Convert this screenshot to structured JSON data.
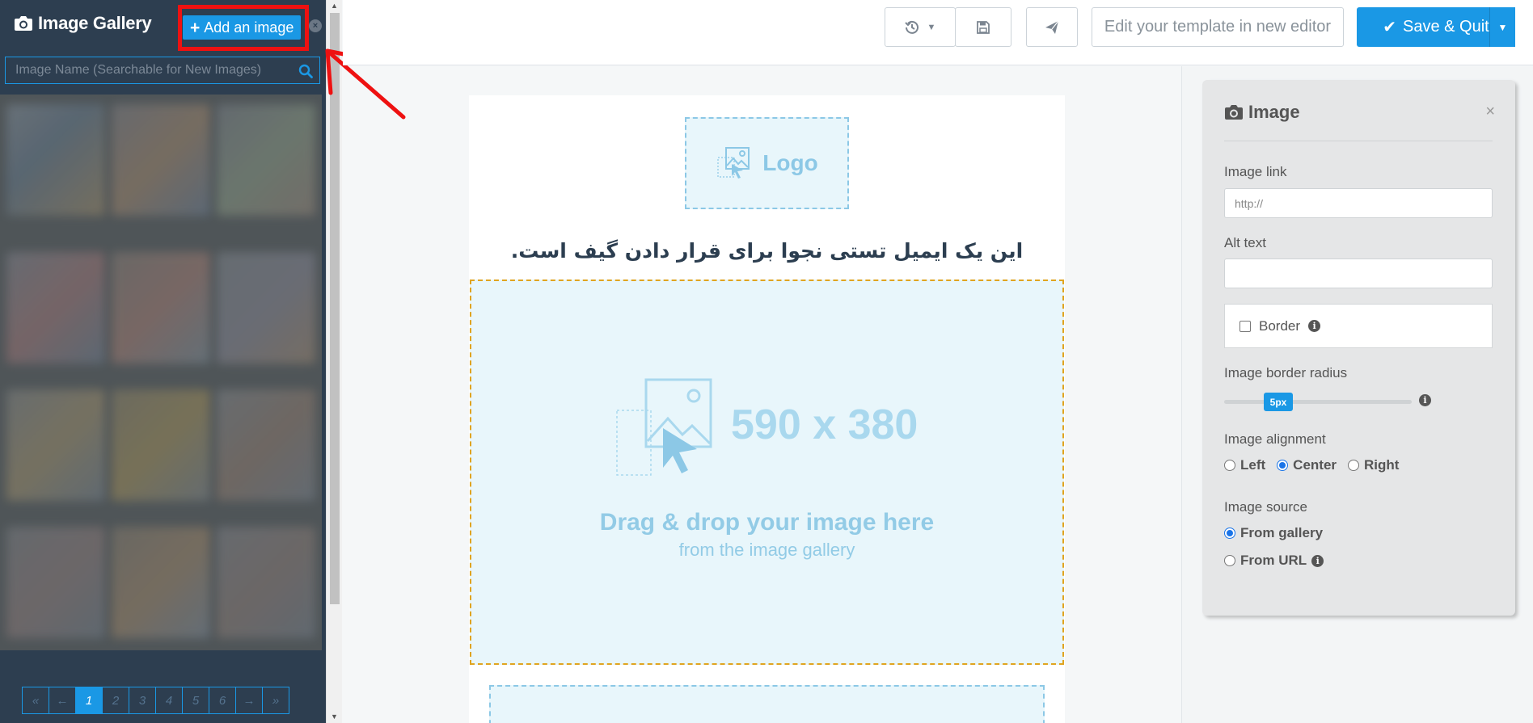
{
  "gallery": {
    "title": "Image Gallery",
    "add_button_label": "Add an image",
    "search_placeholder": "Image Name (Searchable for New Images)",
    "pagination": [
      "«",
      "←",
      "1",
      "2",
      "3",
      "4",
      "5",
      "6",
      "→",
      "»"
    ],
    "active_page": "1"
  },
  "toolbar": {
    "edit_label": "Edit your template in new editor",
    "save_label": "Save & Quit"
  },
  "canvas": {
    "logo_label": "Logo",
    "heading": "این یک ایمیل تستی نجوا برای قرار دادن گیف است.",
    "image_dims": "590 x 380",
    "drag_text": "Drag & drop your image here",
    "drag_subtext": "from the image gallery"
  },
  "panel": {
    "title": "Image",
    "close": "×",
    "image_link_label": "Image link",
    "image_link_placeholder": "http://",
    "alt_text_label": "Alt text",
    "border_label": "Border",
    "radius_label": "Image border radius",
    "radius_value": "5px",
    "alignment_label": "Image alignment",
    "alignment_options": [
      "Left",
      "Center",
      "Right"
    ],
    "alignment_selected": "Center",
    "source_label": "Image source",
    "source_options": [
      "From gallery",
      "From URL"
    ],
    "source_selected": "From gallery"
  },
  "colors": {
    "accent": "#1a98e5",
    "sidebar_bg": "#2d3e50",
    "annotation_red": "#ee1111",
    "placeholder_blue": "#8cc8e6"
  }
}
